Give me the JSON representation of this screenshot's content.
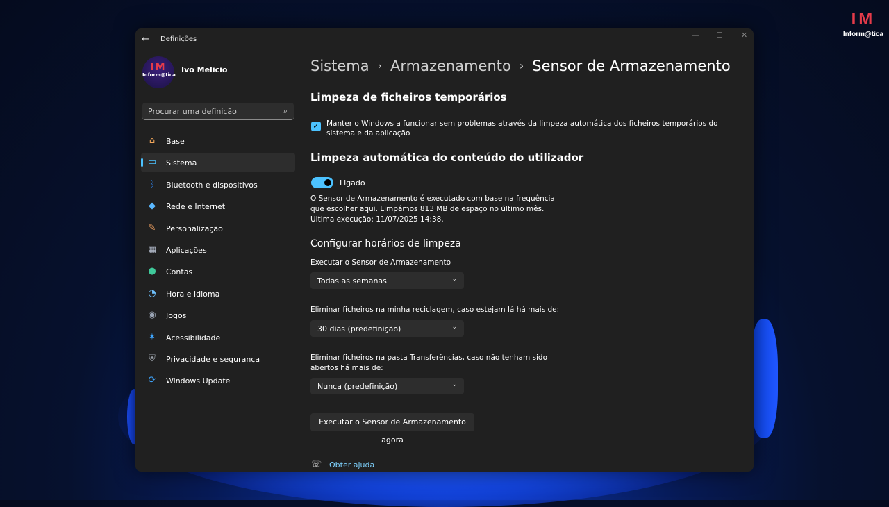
{
  "brand": {
    "logo": "IM",
    "name": "Inform@tica"
  },
  "window": {
    "title": "Definições",
    "back_icon": "←",
    "minimize": "—",
    "maximize": "☐",
    "close": "✕"
  },
  "profile": {
    "logo": "IM",
    "logo_name": "Inform@tica",
    "user_name": "Ivo Melicio"
  },
  "search": {
    "placeholder": "Procurar uma definição"
  },
  "nav": [
    {
      "label": "Base",
      "icon": "home-icon",
      "glyph": "⌂",
      "color": "#f2a65a"
    },
    {
      "label": "Sistema",
      "icon": "monitor-icon",
      "glyph": "▭",
      "color": "#4cc2ff",
      "active": true
    },
    {
      "label": "Bluetooth e dispositivos",
      "icon": "bluetooth-icon",
      "glyph": "ᛒ",
      "color": "#2f8cff"
    },
    {
      "label": "Rede e Internet",
      "icon": "wifi-icon",
      "glyph": "◆",
      "color": "#5ab8ff"
    },
    {
      "label": "Personalização",
      "icon": "brush-icon",
      "glyph": "✎",
      "color": "#f0a060"
    },
    {
      "label": "Aplicações",
      "icon": "apps-icon",
      "glyph": "▦",
      "color": "#b0b8c8"
    },
    {
      "label": "Contas",
      "icon": "person-icon",
      "glyph": "●",
      "color": "#3fc99a"
    },
    {
      "label": "Hora e idioma",
      "icon": "clock-globe-icon",
      "glyph": "◔",
      "color": "#6fc2ff"
    },
    {
      "label": "Jogos",
      "icon": "gamepad-icon",
      "glyph": "◉",
      "color": "#9aa4b4"
    },
    {
      "label": "Acessibilidade",
      "icon": "accessibility-icon",
      "glyph": "✶",
      "color": "#3fa6ff"
    },
    {
      "label": "Privacidade e segurança",
      "icon": "shield-icon",
      "glyph": "⛨",
      "color": "#9aa0a8"
    },
    {
      "label": "Windows Update",
      "icon": "update-icon",
      "glyph": "⟳",
      "color": "#3fa6ff"
    }
  ],
  "breadcrumb": {
    "part1": "Sistema",
    "sep": "›",
    "part2": "Armazenamento",
    "current": "Sensor de Armazenamento"
  },
  "temp_cleanup": {
    "heading": "Limpeza de ficheiros temporários",
    "checkbox_label": "Manter o Windows a funcionar sem problemas através da limpeza automática dos ficheiros temporários do sistema e da aplicação",
    "checked": true
  },
  "auto_cleanup": {
    "heading": "Limpeza automática do conteúdo do utilizador",
    "toggle_label": "Ligado",
    "toggle_on": true,
    "description": "O Sensor de Armazenamento é executado com base na frequência que escolher aqui. Limpámos 813 MB de espaço no último mês. Última execução: 11/07/2025 14:38."
  },
  "schedule": {
    "heading": "Configurar horários de limpeza",
    "run_label": "Executar o Sensor de Armazenamento",
    "run_value": "Todas as semanas",
    "recycle_label": "Eliminar ficheiros na minha reciclagem, caso estejam lá há mais de:",
    "recycle_value": "30 dias (predefinição)",
    "downloads_label": "Eliminar ficheiros na pasta Transferências, caso não tenham sido abertos há mais de:",
    "downloads_value": "Nunca (predefinição)",
    "run_now_button": "Executar o Sensor de Armazenamento agora"
  },
  "help": {
    "label": "Obter ajuda"
  },
  "colors": {
    "accent": "#4cc2ff",
    "window_bg": "#202020",
    "control_bg": "#2d2d2d",
    "brand_red": "#e53b4a"
  }
}
